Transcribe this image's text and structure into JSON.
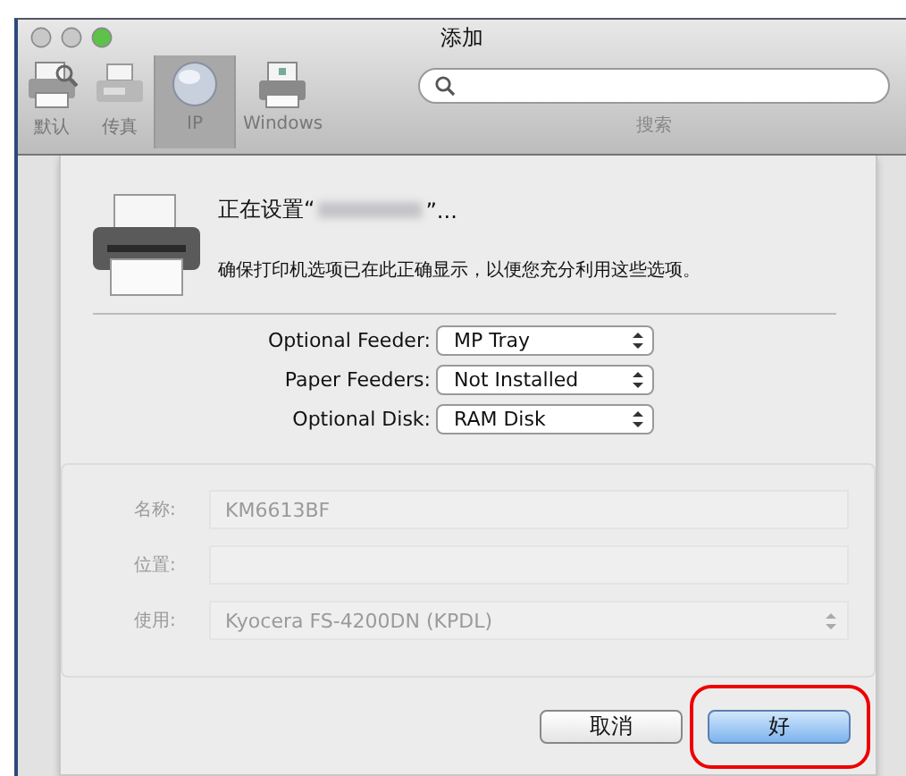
{
  "window": {
    "title": "添加"
  },
  "toolbar": {
    "items": [
      {
        "label": "默认",
        "kind": "printer",
        "selected": false
      },
      {
        "label": "传真",
        "kind": "fax",
        "selected": false
      },
      {
        "label": "IP",
        "kind": "globe",
        "selected": true
      },
      {
        "label": "Windows",
        "kind": "windows",
        "selected": false
      }
    ],
    "search_label": "搜索"
  },
  "sheet": {
    "title_before": "正在设置“",
    "title_after": "”...",
    "message": "确保打印机选项已在此正确显示，以便您充分利用这些选项。",
    "options": [
      {
        "label": "Optional Feeder:",
        "value": "MP Tray"
      },
      {
        "label": "Paper Feeders:",
        "value": "Not Installed"
      },
      {
        "label": "Optional Disk:",
        "value": "RAM Disk"
      }
    ],
    "background_form": [
      {
        "label": "名称:",
        "value": "KM6613BF",
        "kind": "text"
      },
      {
        "label": "位置:",
        "kind": "text"
      },
      {
        "label": "使用:",
        "value": "Kyocera FS-4200DN (KPDL)",
        "kind": "popup"
      }
    ],
    "buttons": [
      {
        "label": "取消",
        "default": false,
        "highlighted": false
      },
      {
        "label": "好",
        "default": true,
        "highlighted": true
      }
    ]
  }
}
